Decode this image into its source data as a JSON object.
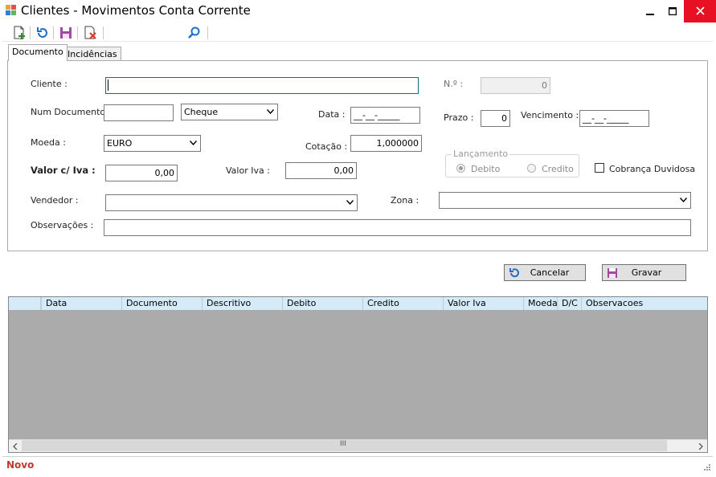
{
  "window": {
    "title": "Clientes - Movimentos Conta Corrente",
    "controls": {
      "minimize": "▁",
      "maximize": "☐",
      "close": "✕"
    }
  },
  "toolbar": {
    "icons": [
      "new-document-icon",
      "refresh-icon",
      "save-icon",
      "delete-document-icon",
      "search-icon"
    ]
  },
  "tabs": [
    {
      "label": "Documento",
      "active": true
    },
    {
      "label": "Incidências",
      "active": false
    }
  ],
  "form": {
    "cliente": {
      "label": "Cliente :",
      "value": ""
    },
    "numero": {
      "label": "N.º :",
      "value": "0"
    },
    "num_documento": {
      "label": "Num Documento :",
      "value": "",
      "tipo": "Cheque"
    },
    "data": {
      "label": "Data :",
      "value": "__-__-_____"
    },
    "prazo": {
      "label": "Prazo :",
      "value": "0"
    },
    "vencimento": {
      "label": "Vencimento :",
      "value": "__-__-_____"
    },
    "moeda": {
      "label": "Moeda :",
      "value": "EURO"
    },
    "cotacao": {
      "label": "Cotação :",
      "value": "1,000000"
    },
    "lancamento": {
      "label": "Lançamento",
      "options": [
        "Debito",
        "Credito"
      ],
      "selected": "Debito"
    },
    "cobranca_duvidosa": {
      "label": "Cobrança Duvidosa",
      "checked": false
    },
    "valor_civa": {
      "label": "Valor c/ Iva :",
      "value": "0,00"
    },
    "valor_iva": {
      "label": "Valor Iva :",
      "value": "0,00"
    },
    "vendedor": {
      "label": "Vendedor :",
      "value": ""
    },
    "zona": {
      "label": "Zona :",
      "value": ""
    },
    "observacoes": {
      "label": "Observações :",
      "value": ""
    }
  },
  "actions": {
    "cancelar": "Cancelar",
    "gravar": "Gravar"
  },
  "grid": {
    "columns": [
      "Data",
      "Documento",
      "Descritivo",
      "Debito",
      "Credito",
      "Valor Iva",
      "Moeda",
      "D/C",
      "Observacoes"
    ],
    "rows": [],
    "scroll_grip": "III"
  },
  "status": {
    "text": "Novo"
  },
  "colors": {
    "accent": "#0078d7",
    "close": "#e81123",
    "status": "#c0392b",
    "grid_header": "#d6ebf8"
  }
}
